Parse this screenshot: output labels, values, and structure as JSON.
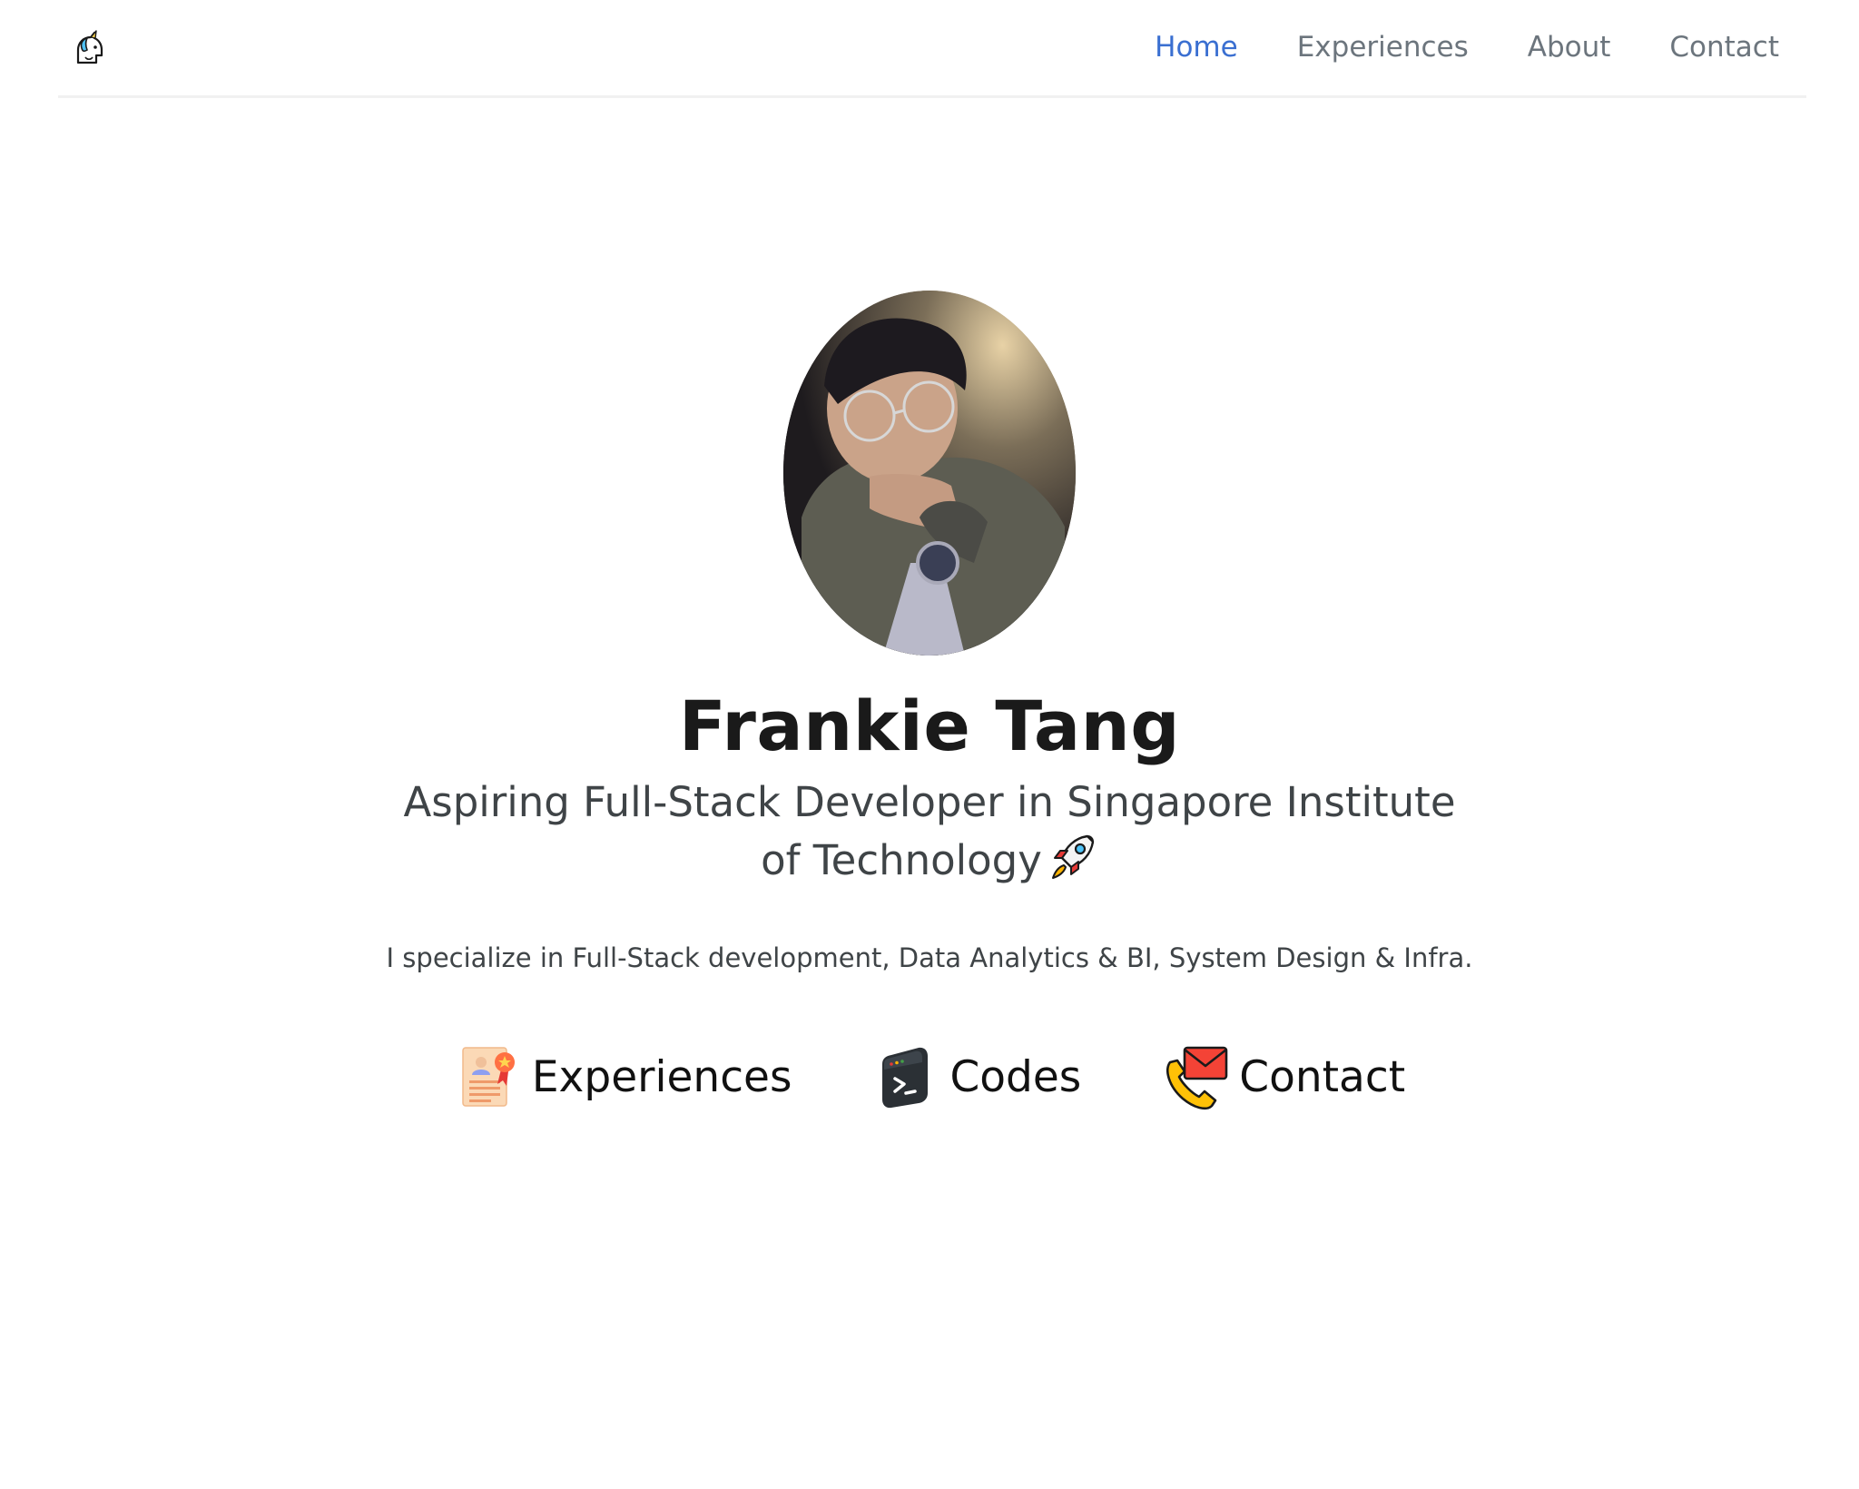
{
  "nav": {
    "brand_icon": "unicorn-icon",
    "links": [
      {
        "label": "Home",
        "active": true
      },
      {
        "label": "Experiences",
        "active": false
      },
      {
        "label": "About",
        "active": false
      },
      {
        "label": "Contact",
        "active": false
      }
    ]
  },
  "hero": {
    "avatar_alt": "profile-photo",
    "name": "Frankie Tang",
    "tagline": "Aspiring Full-Stack Developer in Singapore Institute of Technology",
    "tagline_icon": "rocket-icon",
    "specialize": "I specialize in Full-Stack development, Data Analytics & BI, System Design & Infra."
  },
  "quick_links": [
    {
      "label": "Experiences",
      "icon": "resume-certificate-icon"
    },
    {
      "label": "Codes",
      "icon": "terminal-icon"
    },
    {
      "label": "Contact",
      "icon": "phone-envelope-icon"
    }
  ],
  "colors": {
    "nav_active": "#3a6fd1",
    "nav_inactive": "#6c757d",
    "heading": "#1a1a1a",
    "body_text": "#3f4447"
  }
}
